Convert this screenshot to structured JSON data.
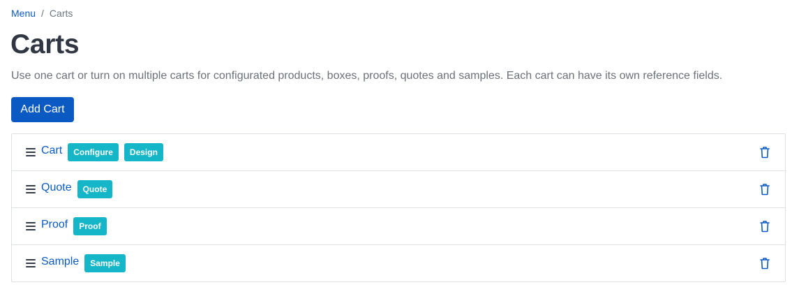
{
  "breadcrumb": {
    "menu_label": "Menu",
    "separator": "/",
    "current": "Carts"
  },
  "page": {
    "title": "Carts",
    "description": "Use one cart or turn on multiple carts for configurated products, boxes, proofs, quotes and samples. Each cart can have its own reference fields.",
    "add_button_label": "Add Cart"
  },
  "carts": [
    {
      "name": "Cart",
      "badges": [
        "Configure",
        "Design"
      ]
    },
    {
      "name": "Quote",
      "badges": [
        "Quote"
      ]
    },
    {
      "name": "Proof",
      "badges": [
        "Proof"
      ]
    },
    {
      "name": "Sample",
      "badges": [
        "Sample"
      ]
    }
  ],
  "icons": {
    "drag": "drag-handle-icon",
    "delete": "trash-icon"
  },
  "colors": {
    "primary": "#0b5ac4",
    "badge": "#14b6c8",
    "border": "#dcdfe3",
    "heading": "#303642",
    "muted": "#6b7079"
  }
}
